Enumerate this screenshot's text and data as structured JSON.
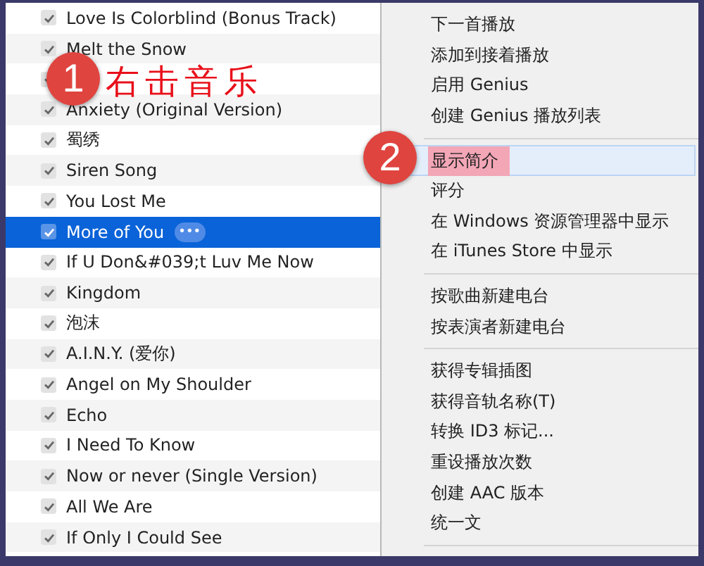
{
  "songs": [
    {
      "title": "Love Is Colorblind (Bonus Track)",
      "checked": true,
      "selected": false
    },
    {
      "title": "Melt the Snow",
      "checked": true,
      "selected": false
    },
    {
      "checked": true
    },
    {
      "title": "Anxiety (Original Version)",
      "checked": true,
      "selected": false
    },
    {
      "title": "蜀绣",
      "checked": true,
      "selected": false
    },
    {
      "title": "Siren Song",
      "checked": true,
      "selected": false
    },
    {
      "title": "You Lost Me",
      "checked": true,
      "selected": false
    },
    {
      "title": "More of You",
      "checked": true,
      "selected": true,
      "more": "•••"
    },
    {
      "title": "If U Don&#039;t Luv Me Now",
      "checked": true,
      "selected": false
    },
    {
      "title": "Kingdom",
      "checked": true,
      "selected": false
    },
    {
      "title": "泡沫",
      "checked": true,
      "selected": false
    },
    {
      "title": "A.I.N.Y. (爱你)",
      "checked": true,
      "selected": false
    },
    {
      "title": "Angel on My Shoulder",
      "checked": true,
      "selected": false
    },
    {
      "title": "Echo",
      "checked": true,
      "selected": false
    },
    {
      "title": "I Need To Know",
      "checked": true,
      "selected": false
    },
    {
      "title": "Now or never (Single Version)",
      "checked": true,
      "selected": false
    },
    {
      "title": "All We Are",
      "checked": true,
      "selected": false
    },
    {
      "title": "If Only I Could See",
      "checked": true,
      "selected": false
    }
  ],
  "context_menu": [
    {
      "kind": "item",
      "label": "下一首播放",
      "selected": false
    },
    {
      "kind": "item",
      "label": "添加到接着播放",
      "selected": false
    },
    {
      "kind": "item",
      "label": "启用 Genius",
      "selected": false
    },
    {
      "kind": "item",
      "label": "创建 Genius 播放列表",
      "selected": false
    },
    {
      "kind": "separator"
    },
    {
      "kind": "item",
      "label": "显示简介",
      "selected": true
    },
    {
      "kind": "item",
      "label": "评分",
      "selected": false
    },
    {
      "kind": "item",
      "label": "在 Windows 资源管理器中显示",
      "selected": false
    },
    {
      "kind": "item",
      "label": "在 iTunes Store 中显示",
      "selected": false
    },
    {
      "kind": "separator"
    },
    {
      "kind": "item",
      "label": "按歌曲新建电台",
      "selected": false
    },
    {
      "kind": "item",
      "label": "按表演者新建电台",
      "selected": false
    },
    {
      "kind": "separator"
    },
    {
      "kind": "item",
      "label": "获得专辑插图",
      "selected": false
    },
    {
      "kind": "item",
      "label": "获得音轨名称(T)",
      "selected": false
    },
    {
      "kind": "item",
      "label": "转换 ID3 标记...",
      "selected": false
    },
    {
      "kind": "item",
      "label": "重设播放次数",
      "selected": false
    },
    {
      "kind": "item",
      "label": "创建 AAC 版本",
      "selected": false
    },
    {
      "kind": "item",
      "label": "统一文",
      "selected": false
    },
    {
      "kind": "separator"
    }
  ],
  "annotations": [
    {
      "number": "1",
      "caption": "右击音乐"
    },
    {
      "number": "2"
    }
  ]
}
